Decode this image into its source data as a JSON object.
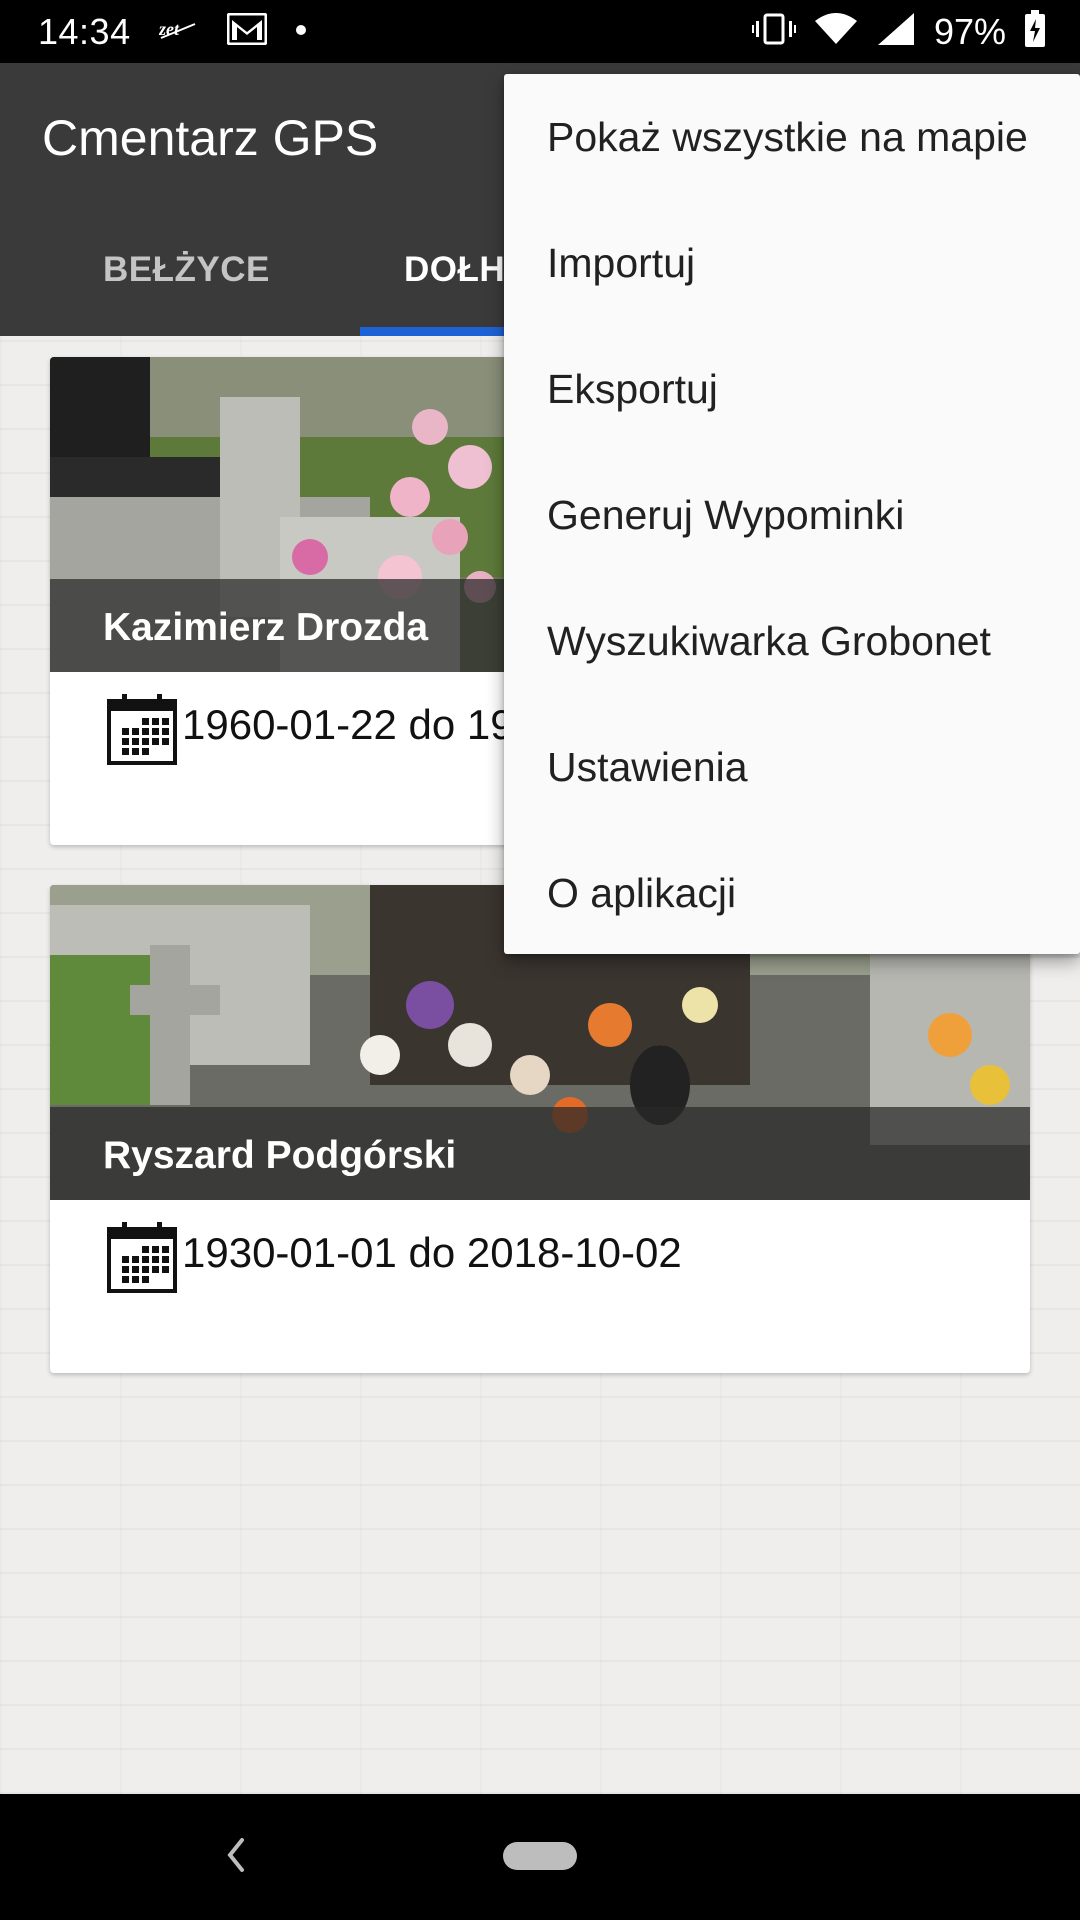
{
  "status_bar": {
    "time": "14:34",
    "battery_percent": "97%",
    "icons": [
      "zet-icon",
      "gmail-icon",
      "dot-icon",
      "vibrate-icon",
      "wifi-icon",
      "signal-icon",
      "battery-charging-icon"
    ]
  },
  "app": {
    "title": "Cmentarz GPS",
    "accent_color": "#1e63d6",
    "toolbar_color": "#3a3a3a"
  },
  "tabs": [
    {
      "label": "BEŁŻYCE",
      "selected": false
    },
    {
      "label": "DOŁHO",
      "selected": true
    }
  ],
  "cards": [
    {
      "name": "Kazimierz Drozda",
      "dates": "1960-01-22 do 19",
      "icon": "calendar-icon"
    },
    {
      "name": "Ryszard Podgórski",
      "dates": "1930-01-01 do 2018-10-02",
      "icon": "calendar-icon"
    }
  ],
  "menu": {
    "items": [
      "Pokaż wszystkie na mapie",
      "Importuj",
      "Eksportuj",
      "Generuj Wypominki",
      "Wyszukiwarka Grobonet",
      "Ustawienia",
      "O aplikacji"
    ]
  },
  "nav_bar": {
    "icons": [
      "back-icon",
      "home-pill-icon"
    ]
  }
}
